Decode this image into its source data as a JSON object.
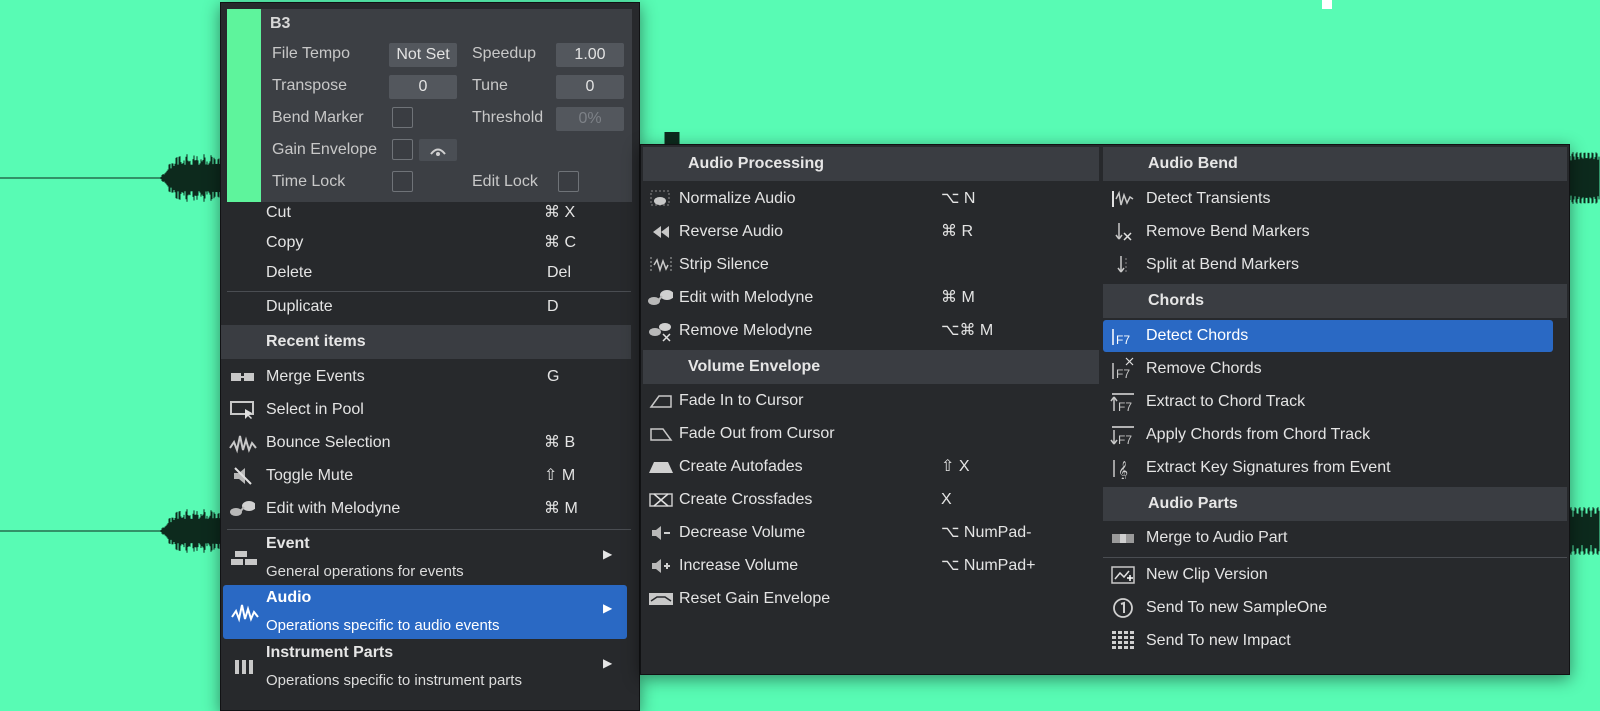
{
  "colors": {
    "background": "#58fbb4",
    "menu_bg": "#27292c",
    "highlight": "#2a69c4",
    "event_color": "#5ef49c"
  },
  "event_properties": {
    "name": "B3",
    "file_tempo_label": "File Tempo",
    "file_tempo_value": "Not Set",
    "speedup_label": "Speedup",
    "speedup_value": "1.00",
    "transpose_label": "Transpose",
    "transpose_value": "0",
    "tune_label": "Tune",
    "tune_value": "0",
    "bend_marker_label": "Bend Marker",
    "threshold_label": "Threshold",
    "threshold_value": "0%",
    "gain_envelope_label": "Gain Envelope",
    "time_lock_label": "Time Lock",
    "edit_lock_label": "Edit Lock"
  },
  "main_menu": {
    "edit_items": [
      {
        "label": "Cut",
        "shortcut": "⌘ X"
      },
      {
        "label": "Copy",
        "shortcut": "⌘ C"
      },
      {
        "label": "Delete",
        "shortcut": "Del"
      }
    ],
    "duplicate": {
      "label": "Duplicate",
      "shortcut": "D"
    },
    "recent_header": "Recent items",
    "recent_items": [
      {
        "label": "Merge Events",
        "shortcut": "G",
        "icon": "merge-events-icon"
      },
      {
        "label": "Select in Pool",
        "shortcut": "",
        "icon": "select-pool-icon"
      },
      {
        "label": "Bounce Selection",
        "shortcut": "⌘ B",
        "icon": "bounce-icon"
      },
      {
        "label": "Toggle Mute",
        "shortcut": "⇧ M",
        "icon": "mute-icon"
      },
      {
        "label": "Edit with Melodyne",
        "shortcut": "⌘ M",
        "icon": "melodyne-icon"
      }
    ],
    "submenus": [
      {
        "title": "Event",
        "description": "General operations for events"
      },
      {
        "title": "Audio",
        "description": "Operations specific to audio events"
      },
      {
        "title": "Instrument Parts",
        "description": "Operations specific to instrument parts"
      }
    ]
  },
  "audio_submenu": {
    "audio_processing": {
      "header": "Audio Processing",
      "items": [
        {
          "label": "Normalize Audio",
          "shortcut": "⌥ N"
        },
        {
          "label": "Reverse Audio",
          "shortcut": "⌘ R"
        },
        {
          "label": "Strip Silence",
          "shortcut": ""
        },
        {
          "label": "Edit with Melodyne",
          "shortcut": "⌘ M"
        },
        {
          "label": "Remove Melodyne",
          "shortcut": "⌥⌘ M"
        }
      ]
    },
    "volume_envelope": {
      "header": "Volume Envelope",
      "items": [
        {
          "label": "Fade In to Cursor",
          "shortcut": ""
        },
        {
          "label": "Fade Out from Cursor",
          "shortcut": ""
        },
        {
          "label": "Create Autofades",
          "shortcut": "⇧ X"
        },
        {
          "label": "Create Crossfades",
          "shortcut": "X"
        },
        {
          "label": "Decrease Volume",
          "shortcut": "⌥ NumPad-"
        },
        {
          "label": "Increase Volume",
          "shortcut": "⌥ NumPad+"
        },
        {
          "label": "Reset Gain Envelope",
          "shortcut": ""
        }
      ]
    },
    "audio_bend": {
      "header": "Audio Bend",
      "items": [
        {
          "label": "Detect Transients"
        },
        {
          "label": "Remove Bend Markers"
        },
        {
          "label": "Split at Bend Markers"
        }
      ]
    },
    "chords": {
      "header": "Chords",
      "items": [
        {
          "label": "Detect Chords",
          "icon_text": "F7"
        },
        {
          "label": "Remove Chords",
          "icon_text": "F7"
        },
        {
          "label": "Extract to Chord Track",
          "icon_text": "F7"
        },
        {
          "label": "Apply Chords from Chord Track",
          "icon_text": "F7"
        },
        {
          "label": "Extract Key Signatures from Event",
          "icon_text": "𝄞"
        }
      ]
    },
    "audio_parts": {
      "header": "Audio Parts",
      "items": [
        {
          "label": "Merge to Audio Part"
        }
      ]
    },
    "other_items": [
      {
        "label": "New Clip Version"
      },
      {
        "label": "Send To new SampleOne"
      },
      {
        "label": "Send To new Impact"
      }
    ]
  }
}
